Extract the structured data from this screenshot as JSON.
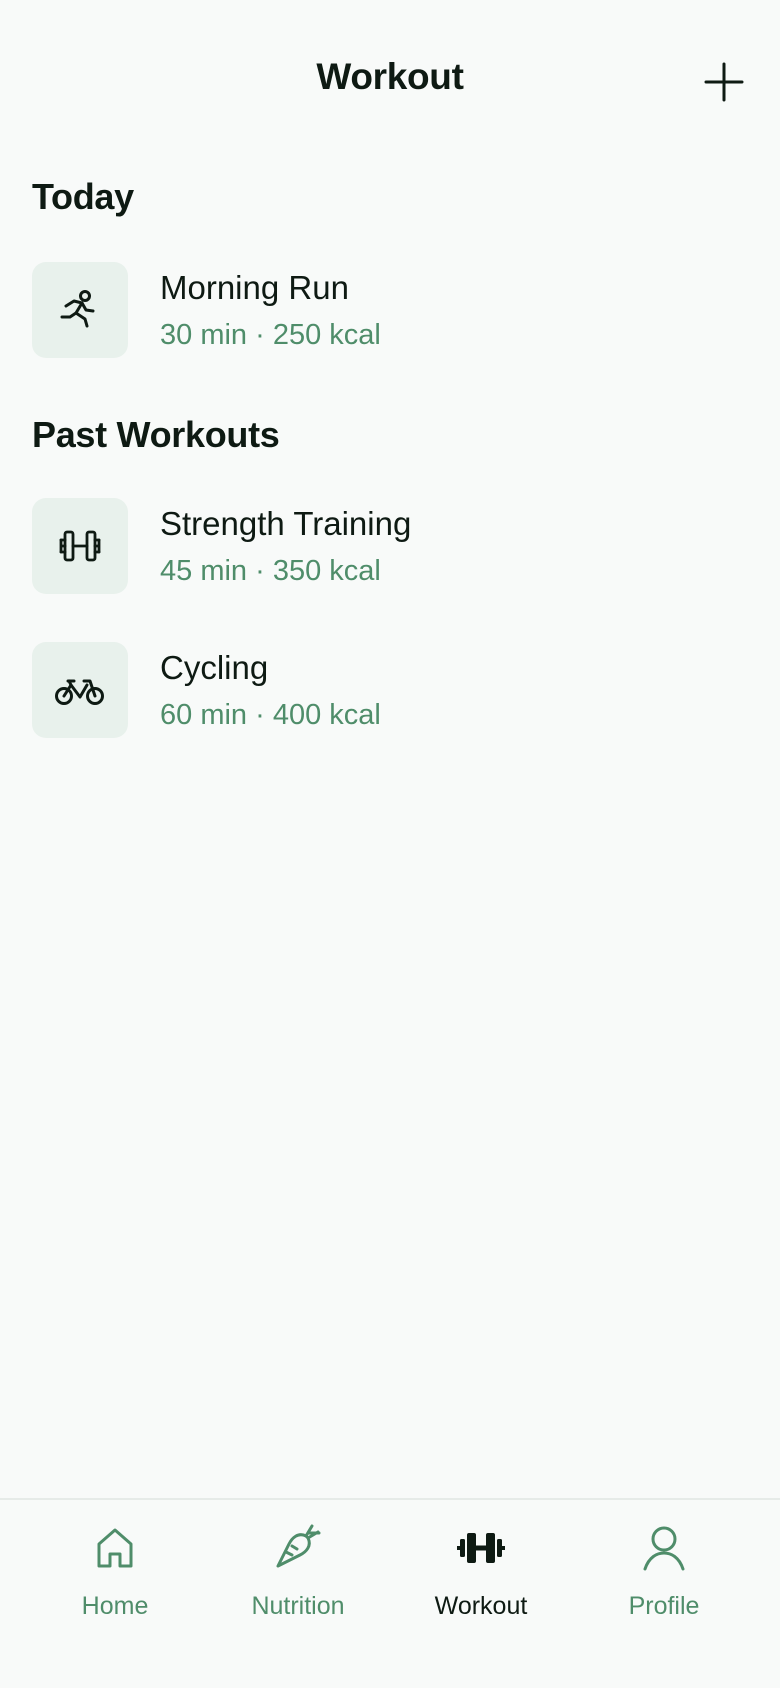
{
  "header": {
    "title": "Workout",
    "add_icon": "plus-icon"
  },
  "today": {
    "title": "Today",
    "items": [
      {
        "name": "Morning Run",
        "meta": "30 min · 250 kcal",
        "icon": "running-icon"
      }
    ]
  },
  "past": {
    "title": "Past Workouts",
    "items": [
      {
        "name": "Strength Training",
        "meta": "45 min · 350 kcal",
        "icon": "dumbbell-icon"
      },
      {
        "name": "Cycling",
        "meta": "60 min · 400 kcal",
        "icon": "bicycle-icon"
      }
    ]
  },
  "nav": {
    "items": [
      {
        "label": "Home",
        "icon": "home-icon",
        "active": false
      },
      {
        "label": "Nutrition",
        "icon": "carrot-icon",
        "active": false
      },
      {
        "label": "Workout",
        "icon": "dumbbell-icon",
        "active": true
      },
      {
        "label": "Profile",
        "icon": "user-icon",
        "active": false
      }
    ]
  },
  "colors": {
    "background": "#f8faf9",
    "text": "#0e1a13",
    "accent_green": "#4f8d6a",
    "thumb_bg": "#e8f1ec"
  }
}
